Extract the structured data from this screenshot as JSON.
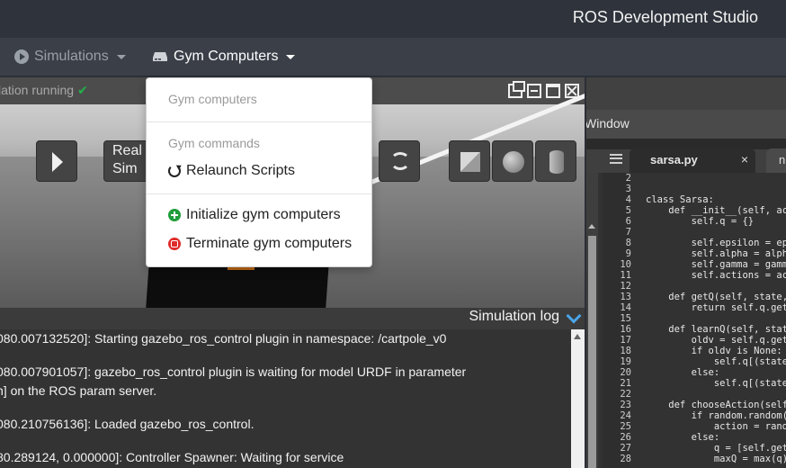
{
  "header": {
    "brand": "ROS Development Studio"
  },
  "menubar": {
    "simulations": {
      "label": "Simulations",
      "icon": "play-circle-icon"
    },
    "gym": {
      "label": "Gym Computers",
      "icon": "server-icon"
    }
  },
  "simulation": {
    "status": "lation running",
    "controls": {
      "real_sim_line1": "Real",
      "real_sim_line2": "Sim"
    },
    "log_title": "Simulation log",
    "log_lines": [
      "080.007132520]: Starting gazebo_ros_control plugin in namespace: /cartpole_v0",
      "080.007901057]: gazebo_ros_control plugin is waiting for model URDF in parameter",
      "n] on the ROS param server.",
      "080.210756136]: Loaded gazebo_ros_control.",
      "80.289124, 0.000000]: Controller Spawner: Waiting for service"
    ]
  },
  "editor": {
    "window_label": "Window",
    "active_tab": "sarsa.py",
    "close_glyph": "×",
    "second_tab": "n",
    "lines": [
      {
        "no": "2",
        "text": ""
      },
      {
        "no": "3",
        "text": ""
      },
      {
        "no": "4",
        "text": "class Sarsa:"
      },
      {
        "no": "5",
        "text": "    def __init__(self, act"
      },
      {
        "no": "6",
        "text": "        self.q = {}"
      },
      {
        "no": "7",
        "text": ""
      },
      {
        "no": "8",
        "text": "        self.epsilon = eps"
      },
      {
        "no": "9",
        "text": "        self.alpha = alpha"
      },
      {
        "no": "10",
        "text": "        self.gamma = gamma"
      },
      {
        "no": "11",
        "text": "        self.actions = act"
      },
      {
        "no": "12",
        "text": ""
      },
      {
        "no": "13",
        "text": "    def getQ(self, state, "
      },
      {
        "no": "14",
        "text": "        return self.q.get("
      },
      {
        "no": "15",
        "text": ""
      },
      {
        "no": "16",
        "text": "    def learnQ(self, state"
      },
      {
        "no": "17",
        "text": "        oldv = self.q.get("
      },
      {
        "no": "18",
        "text": "        if oldv is None:"
      },
      {
        "no": "19",
        "text": "            self.q[(state,"
      },
      {
        "no": "20",
        "text": "        else:"
      },
      {
        "no": "21",
        "text": "            self.q[(state,"
      },
      {
        "no": "22",
        "text": ""
      },
      {
        "no": "23",
        "text": "    def chooseAction(self,"
      },
      {
        "no": "24",
        "text": "        if random.random()"
      },
      {
        "no": "25",
        "text": "            action = rando"
      },
      {
        "no": "26",
        "text": "        else:"
      },
      {
        "no": "27",
        "text": "            q = [self.getQ"
      },
      {
        "no": "28",
        "text": "            maxQ = max(q)"
      }
    ]
  },
  "dropdown": {
    "header_computers": "Gym computers",
    "header_commands": "Gym commands",
    "relaunch": "Relaunch Scripts",
    "initialize": "Initialize gym computers",
    "terminate": "Terminate gym computers"
  },
  "colors": {
    "success": "#1f9d3a",
    "danger": "#e02b2b",
    "accent": "#4aa4e8"
  }
}
